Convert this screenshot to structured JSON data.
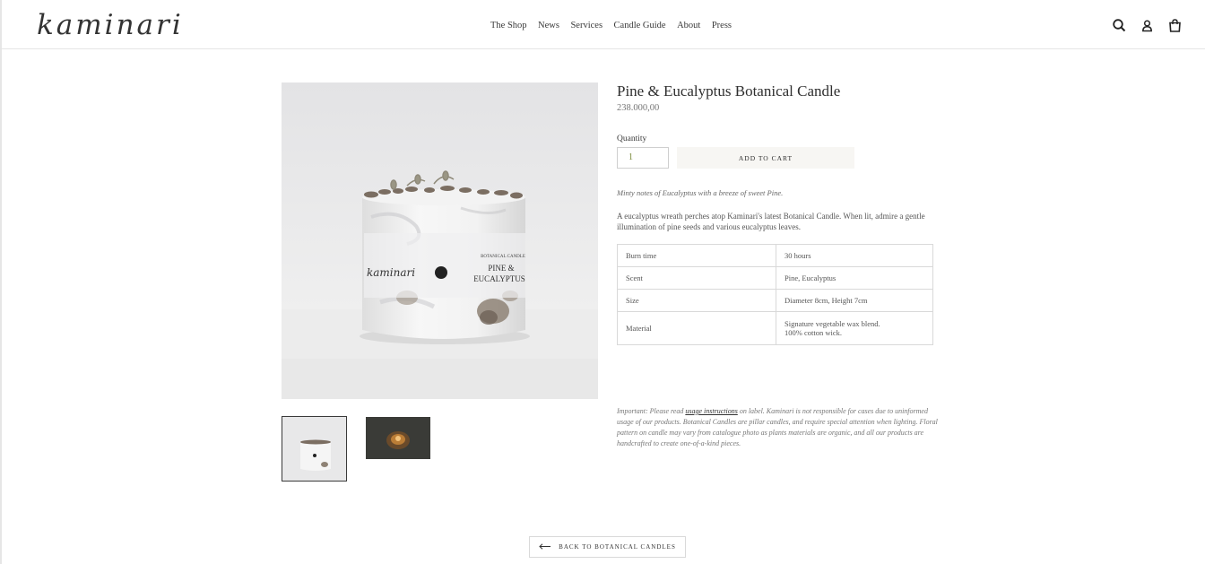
{
  "header": {
    "logo": "kaminari",
    "nav": [
      "The Shop",
      "News",
      "Services",
      "Candle Guide",
      "About",
      "Press"
    ],
    "icons": [
      "search-icon",
      "account-icon",
      "cart-icon"
    ]
  },
  "product": {
    "title": "Pine & Eucalyptus Botanical Candle",
    "price": "238.000,00",
    "quantity_label": "Quantity",
    "quantity_value": "1",
    "add_to_cart": "ADD TO CART",
    "tagline": "Minty notes of Eucalyptus with a breeze of sweet Pine.",
    "description": "A eucalyptus wreath perches atop Kaminari's latest Botanical Candle. When lit, admire a gentle illumination of pine seeds and various eucalyptus leaves.",
    "specs": [
      {
        "key": "Burn time",
        "value": "30 hours"
      },
      {
        "key": "Scent",
        "value": "Pine, Eucalyptus"
      },
      {
        "key": "Size",
        "value": "Diameter 8cm, Height 7cm"
      },
      {
        "key": "Material",
        "value": "Signature vegetable wax blend.",
        "value2": "100% cotton wick."
      }
    ],
    "label_text": {
      "brand": "kaminari",
      "line1": "BOTANICAL CANDLE",
      "line2": "PINE &",
      "line3": "EUCALYPTUS"
    },
    "notice": {
      "before": "Important: Please read ",
      "link": "usage instructions",
      "after": " on label. Kaminari is not responsible for cases due to uninformed usage of our products. Botanical Candles are pillar candles, and require special attention when lighting. Floral pattern on candle may vary from catalogue photo as plants materials are organic, and all our products are handcrafted to create one-of-a-kind pieces."
    }
  },
  "footer": {
    "back_label": "BACK TO BOTANICAL CANDLES"
  }
}
